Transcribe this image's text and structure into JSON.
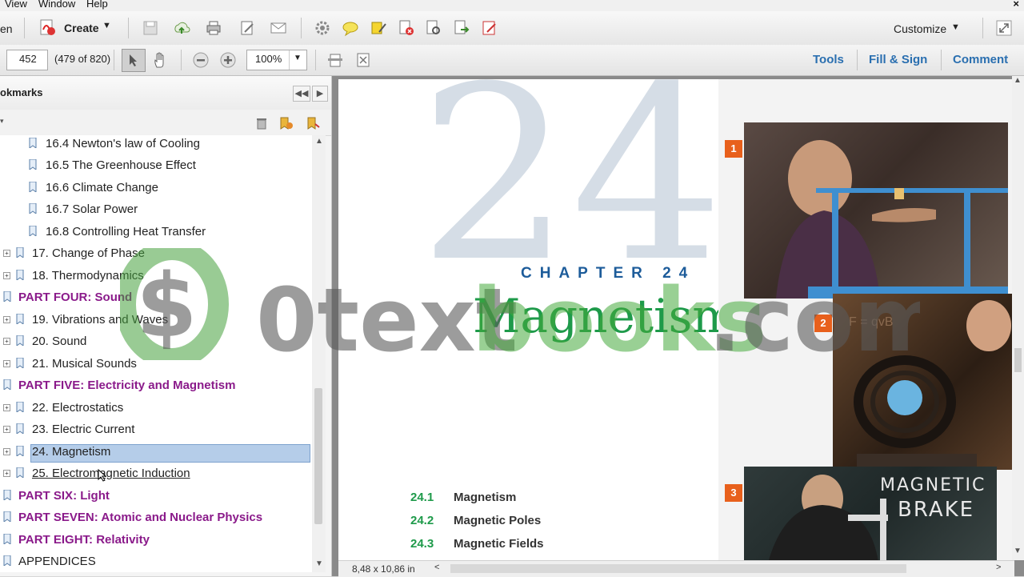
{
  "menu": {
    "items": [
      "View",
      "Window",
      "Help"
    ],
    "close_label": "×"
  },
  "toolbar": {
    "open_label": "en",
    "create_label": "Create",
    "customize_label": "Customize",
    "page_value": "452",
    "page_info": "(479 of 820)",
    "zoom_value": "100%",
    "tools_label": "Tools",
    "fill_sign_label": "Fill & Sign",
    "comment_label": "Comment"
  },
  "sidebar": {
    "title": "okmarks",
    "items": [
      {
        "label": "16.4 Newton's law of Cooling",
        "type": "sub"
      },
      {
        "label": "16.5 The Greenhouse Effect",
        "type": "sub"
      },
      {
        "label": "16.6 Climate Change",
        "type": "sub"
      },
      {
        "label": "16.7 Solar Power",
        "type": "sub"
      },
      {
        "label": "16.8 Controlling Heat Transfer",
        "type": "sub"
      },
      {
        "label": "17. Change of Phase",
        "type": "chapter"
      },
      {
        "label": "18. Thermodynamics",
        "type": "chapter"
      },
      {
        "label": "PART FOUR: Sound",
        "type": "part"
      },
      {
        "label": "19. Vibrations and Waves",
        "type": "chapter"
      },
      {
        "label": "20. Sound",
        "type": "chapter"
      },
      {
        "label": "21. Musical Sounds",
        "type": "chapter"
      },
      {
        "label": "PART FIVE: Electricity and Magnetism",
        "type": "part"
      },
      {
        "label": "22. Electrostatics",
        "type": "chapter"
      },
      {
        "label": "23. Electric Current",
        "type": "chapter"
      },
      {
        "label": "24. Magnetism",
        "type": "chapter"
      },
      {
        "label": "25. Electromagnetic Induction",
        "type": "chapter"
      },
      {
        "label": "PART SIX: Light",
        "type": "part"
      },
      {
        "label": "PART SEVEN: Atomic and Nuclear Physics",
        "type": "part"
      },
      {
        "label": "PART EIGHT: Relativity",
        "type": "part"
      },
      {
        "label": "APPENDICES",
        "type": "appendix"
      }
    ],
    "selected_label": "24. Magnetism"
  },
  "page": {
    "big_number": "24",
    "chapter_label": "CHAPTER 24",
    "chapter_title": "Magnetism",
    "toc": [
      {
        "num": "24.1",
        "title": "Magnetism"
      },
      {
        "num": "24.2",
        "title": "Magnetic Poles"
      },
      {
        "num": "24.3",
        "title": "Magnetic Fields"
      }
    ],
    "photo_tags": [
      "1",
      "2",
      "3"
    ],
    "board_text_1": "MAGNETIC",
    "board_text_2": "BRAKE",
    "board_formula": "F = qvB"
  },
  "statusbar": {
    "page_size": "8,48 x 10,86 in"
  },
  "watermark": {
    "text_1": "0text",
    "text_2": "books",
    "text_3": ".com"
  },
  "colors": {
    "accent_blue": "#2a6fb0",
    "part_purple": "#8a1a8a",
    "magnetism_green": "#1e9a4a",
    "selection": "#b5cde9"
  }
}
